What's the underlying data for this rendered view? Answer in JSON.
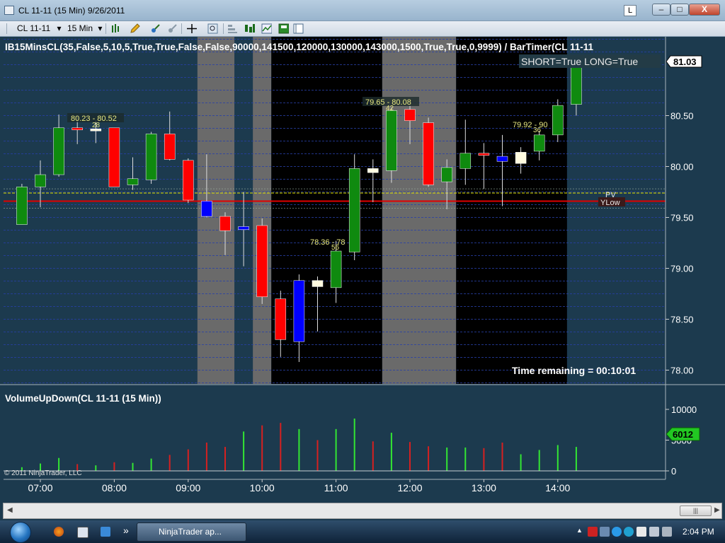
{
  "window": {
    "title": "CL 11-11 (15 Min)  9/26/2011",
    "l_button": "L",
    "minimize": "–",
    "maximize": "□",
    "close": "X"
  },
  "toolbar": {
    "instrument": "CL 11-11",
    "interval": "15 Min",
    "dropdown_arrow": "▾"
  },
  "indicator_label": "IB15MinsCL(35,False,5,10,5,True,True,False,False,90000,141500,120000,130000,143000,1500,True,True,0,9999)  /  BarTimer(CL  11-11",
  "signal_text": "SHORT=True LONG=True",
  "last_price_badge": "81.03",
  "time_remaining": "Time remaining = 00:10:01",
  "volume_panel_title": "VolumeUpDown(CL 11-11 (15 Min))",
  "volume_badge": "6012",
  "copyright": "© 2011 NinjaTrader, LLC",
  "line_labels": {
    "pv": "PV",
    "ylow": "YLow"
  },
  "annotations": [
    {
      "range": "80.23 - 80.52",
      "count": "28"
    },
    {
      "range": "78.36 - 78",
      "count": "56"
    },
    {
      "range": "79.65 - 80.08",
      "count": "42"
    },
    {
      "range": "79.92 - 90",
      "count": "36"
    }
  ],
  "taskbar": {
    "app_button": "NinjaTrader ap...",
    "chevron": "»",
    "clock": "2:04 PM"
  },
  "colors": {
    "background": "#1c3a4e",
    "up_bar": "#0f8a0f",
    "down_bar": "#ff0000",
    "ib_bar": "#0000ff",
    "neutral_bar": "#fffbe0",
    "shade_gray": "#6a6a6a",
    "shade_black": "#000000",
    "vol_up": "#33e633",
    "vol_down": "#d62020",
    "pv_line": "#e8e800",
    "ylow_line": "#e00000"
  },
  "chart_data": {
    "type": "candlestick",
    "title": "CL 11-11 (15 Min)",
    "date": "9/26/2011",
    "price_axis": {
      "ticks": [
        "78.00",
        "78.50",
        "79.00",
        "79.50",
        "80.00",
        "80.50"
      ],
      "ylim": [
        77.9,
        81.1
      ]
    },
    "time_axis": {
      "ticks": [
        "07:00",
        "08:00",
        "09:00",
        "10:00",
        "11:00",
        "12:00",
        "13:00",
        "14:00"
      ]
    },
    "volume_axis": {
      "ticks": [
        "10000",
        "5000",
        "0"
      ],
      "ylim": [
        0,
        12000
      ]
    },
    "levels": {
      "PV": 79.74,
      "YLow": 79.66
    },
    "shaded_periods": [
      {
        "from": "09:15",
        "to": "09:45",
        "color": "gray"
      },
      {
        "from": "10:00",
        "to": "10:15",
        "color": "gray"
      },
      {
        "from": "10:15",
        "to": "11:45",
        "color": "black"
      },
      {
        "from": "11:45",
        "to": "12:45",
        "color": "gray"
      },
      {
        "from": "12:45",
        "to": "14:15",
        "color": "black"
      }
    ],
    "candles": [
      {
        "time": "06:45",
        "open": 79.43,
        "high": 79.83,
        "low": 79.43,
        "close": 79.8,
        "color": "up"
      },
      {
        "time": "07:00",
        "open": 79.8,
        "high": 80.06,
        "low": 79.6,
        "close": 79.92,
        "color": "up"
      },
      {
        "time": "07:15",
        "open": 79.92,
        "high": 80.51,
        "low": 79.9,
        "close": 80.38,
        "color": "up"
      },
      {
        "time": "07:30",
        "open": 80.38,
        "high": 80.5,
        "low": 80.22,
        "close": 80.36,
        "color": "down"
      },
      {
        "time": "07:45",
        "open": 80.35,
        "high": 80.45,
        "low": 80.23,
        "close": 80.37,
        "color": "neutral"
      },
      {
        "time": "08:00",
        "open": 80.38,
        "high": 80.38,
        "low": 79.8,
        "close": 79.8,
        "color": "down"
      },
      {
        "time": "08:15",
        "open": 79.82,
        "high": 80.09,
        "low": 79.77,
        "close": 79.88,
        "color": "up"
      },
      {
        "time": "08:30",
        "open": 79.87,
        "high": 80.34,
        "low": 79.83,
        "close": 80.32,
        "color": "up"
      },
      {
        "time": "08:45",
        "open": 80.32,
        "high": 80.54,
        "low": 80.06,
        "close": 80.07,
        "color": "down"
      },
      {
        "time": "09:00",
        "open": 80.06,
        "high": 80.08,
        "low": 79.64,
        "close": 79.67,
        "color": "down"
      },
      {
        "time": "09:15",
        "open": 79.66,
        "high": 80.12,
        "low": 79.5,
        "close": 79.51,
        "color": "ib"
      },
      {
        "time": "09:30",
        "open": 79.51,
        "high": 79.55,
        "low": 79.13,
        "close": 79.37,
        "color": "down"
      },
      {
        "time": "09:45",
        "open": 79.41,
        "high": 79.75,
        "low": 79.02,
        "close": 79.38,
        "color": "ib"
      },
      {
        "time": "10:00",
        "open": 79.42,
        "high": 79.49,
        "low": 78.65,
        "close": 78.72,
        "color": "down"
      },
      {
        "time": "10:15",
        "open": 78.7,
        "high": 78.78,
        "low": 78.13,
        "close": 78.3,
        "color": "down"
      },
      {
        "time": "10:30",
        "open": 78.88,
        "high": 78.94,
        "low": 78.08,
        "close": 78.28,
        "color": "ib"
      },
      {
        "time": "10:45",
        "open": 78.82,
        "high": 78.92,
        "low": 78.38,
        "close": 78.88,
        "color": "neutral"
      },
      {
        "time": "11:00",
        "open": 78.81,
        "high": 79.27,
        "low": 78.66,
        "close": 79.17,
        "color": "up"
      },
      {
        "time": "11:15",
        "open": 79.16,
        "high": 80.12,
        "low": 79.08,
        "close": 79.98,
        "color": "up"
      },
      {
        "time": "11:30",
        "open": 79.94,
        "high": 80.07,
        "low": 79.65,
        "close": 79.98,
        "color": "neutral"
      },
      {
        "time": "11:45",
        "open": 79.96,
        "high": 80.58,
        "low": 79.84,
        "close": 80.55,
        "color": "up"
      },
      {
        "time": "12:00",
        "open": 80.56,
        "high": 80.6,
        "low": 80.22,
        "close": 80.45,
        "color": "down"
      },
      {
        "time": "12:15",
        "open": 80.43,
        "high": 80.48,
        "low": 79.8,
        "close": 79.82,
        "color": "down"
      },
      {
        "time": "12:30",
        "open": 79.85,
        "high": 80.07,
        "low": 79.58,
        "close": 79.99,
        "color": "up"
      },
      {
        "time": "12:45",
        "open": 79.98,
        "high": 80.46,
        "low": 79.82,
        "close": 80.13,
        "color": "up"
      },
      {
        "time": "13:00",
        "open": 80.13,
        "high": 80.23,
        "low": 79.78,
        "close": 80.11,
        "color": "down"
      },
      {
        "time": "13:15",
        "open": 80.1,
        "high": 80.31,
        "low": 79.61,
        "close": 80.05,
        "color": "ib"
      },
      {
        "time": "13:30",
        "open": 80.03,
        "high": 80.19,
        "low": 79.93,
        "close": 80.14,
        "color": "neutral"
      },
      {
        "time": "13:45",
        "open": 80.15,
        "high": 80.35,
        "low": 80.06,
        "close": 80.31,
        "color": "up"
      },
      {
        "time": "14:00",
        "open": 80.31,
        "high": 80.66,
        "low": 80.24,
        "close": 80.6,
        "color": "up"
      },
      {
        "time": "14:15",
        "open": 80.61,
        "high": 81.03,
        "low": 80.5,
        "close": 81.03,
        "color": "up"
      }
    ],
    "volume": [
      {
        "time": "06:45",
        "value": 600,
        "dir": "up"
      },
      {
        "time": "07:00",
        "value": 1200,
        "dir": "up"
      },
      {
        "time": "07:15",
        "value": 2100,
        "dir": "up"
      },
      {
        "time": "07:30",
        "value": 1100,
        "dir": "down"
      },
      {
        "time": "07:45",
        "value": 900,
        "dir": "up"
      },
      {
        "time": "08:00",
        "value": 1400,
        "dir": "down"
      },
      {
        "time": "08:15",
        "value": 1300,
        "dir": "up"
      },
      {
        "time": "08:30",
        "value": 2000,
        "dir": "up"
      },
      {
        "time": "08:45",
        "value": 2600,
        "dir": "down"
      },
      {
        "time": "09:00",
        "value": 3500,
        "dir": "down"
      },
      {
        "time": "09:15",
        "value": 4600,
        "dir": "down"
      },
      {
        "time": "09:30",
        "value": 3900,
        "dir": "down"
      },
      {
        "time": "09:45",
        "value": 6400,
        "dir": "up"
      },
      {
        "time": "10:00",
        "value": 7400,
        "dir": "down"
      },
      {
        "time": "10:15",
        "value": 7800,
        "dir": "down"
      },
      {
        "time": "10:30",
        "value": 6800,
        "dir": "up"
      },
      {
        "time": "10:45",
        "value": 5000,
        "dir": "down"
      },
      {
        "time": "11:00",
        "value": 6800,
        "dir": "up"
      },
      {
        "time": "11:15",
        "value": 8500,
        "dir": "up"
      },
      {
        "time": "11:30",
        "value": 4800,
        "dir": "down"
      },
      {
        "time": "11:45",
        "value": 6200,
        "dir": "up"
      },
      {
        "time": "12:00",
        "value": 4700,
        "dir": "down"
      },
      {
        "time": "12:15",
        "value": 4000,
        "dir": "down"
      },
      {
        "time": "12:30",
        "value": 3800,
        "dir": "up"
      },
      {
        "time": "12:45",
        "value": 3800,
        "dir": "up"
      },
      {
        "time": "13:00",
        "value": 3700,
        "dir": "down"
      },
      {
        "time": "13:15",
        "value": 4600,
        "dir": "down"
      },
      {
        "time": "13:30",
        "value": 2700,
        "dir": "up"
      },
      {
        "time": "13:45",
        "value": 3400,
        "dir": "up"
      },
      {
        "time": "14:00",
        "value": 4200,
        "dir": "up"
      },
      {
        "time": "14:15",
        "value": 3900,
        "dir": "up"
      }
    ]
  }
}
